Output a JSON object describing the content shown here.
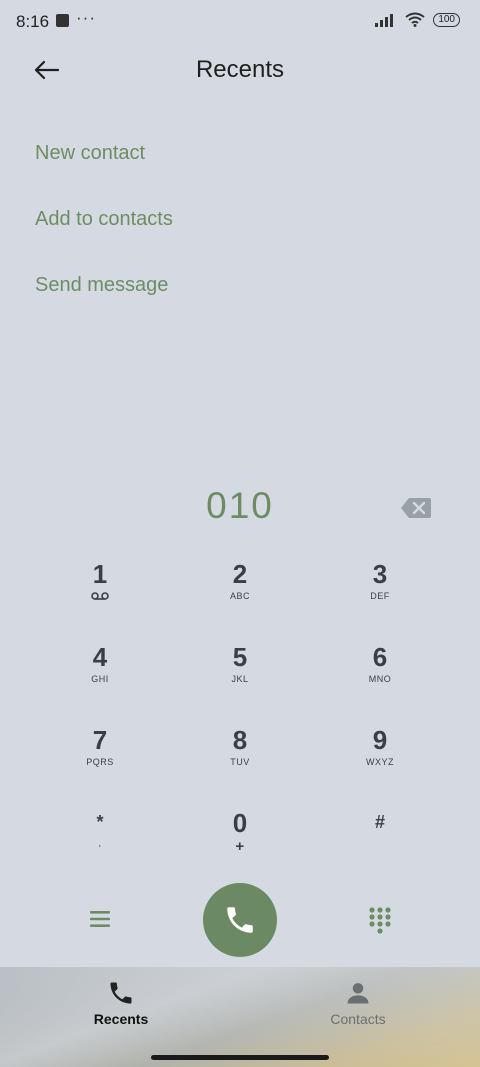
{
  "status": {
    "time": "8:16",
    "more": "···",
    "battery": "100"
  },
  "header": {
    "title": "Recents"
  },
  "actions": [
    {
      "label": "New contact"
    },
    {
      "label": "Add to contacts"
    },
    {
      "label": "Send message"
    }
  ],
  "dialer": {
    "number": "010"
  },
  "keypad": [
    {
      "digit": "1",
      "letters": ""
    },
    {
      "digit": "2",
      "letters": "ABC"
    },
    {
      "digit": "3",
      "letters": "DEF"
    },
    {
      "digit": "4",
      "letters": "GHI"
    },
    {
      "digit": "5",
      "letters": "JKL"
    },
    {
      "digit": "6",
      "letters": "MNO"
    },
    {
      "digit": "7",
      "letters": "PQRS"
    },
    {
      "digit": "8",
      "letters": "TUV"
    },
    {
      "digit": "9",
      "letters": "WXYZ"
    },
    {
      "digit": "*",
      "letters": ","
    },
    {
      "digit": "0",
      "letters": "+"
    },
    {
      "digit": "#",
      "letters": ""
    }
  ],
  "tabs": [
    {
      "label": "Recents",
      "icon": "phone-icon",
      "active": true
    },
    {
      "label": "Contacts",
      "icon": "person-icon",
      "active": false
    }
  ],
  "colors": {
    "accent": "#6e8c64",
    "call_button": "#6b8a64",
    "background": "#d5dae2"
  }
}
